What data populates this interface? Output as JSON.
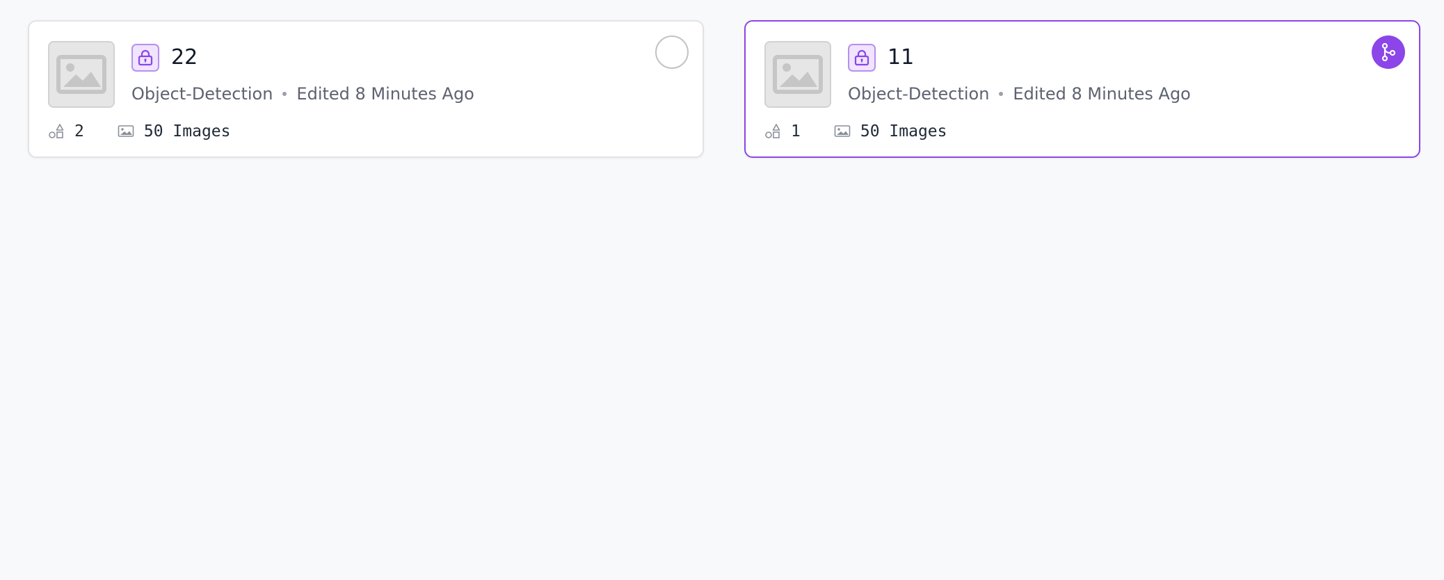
{
  "cards": [
    {
      "title": "22",
      "type": "Object-Detection",
      "edited": "Edited 8 Minutes Ago",
      "classes_count": "2",
      "images_label": "50 Images",
      "selected": false
    },
    {
      "title": "11",
      "type": "Object-Detection",
      "edited": "Edited 8 Minutes Ago",
      "classes_count": "1",
      "images_label": "50 Images",
      "selected": true
    }
  ],
  "icons": {
    "thumbnail": "image-placeholder-icon",
    "lock": "lock-icon",
    "classes": "shapes-icon",
    "images": "image-icon",
    "selected": "git-fork-icon"
  },
  "colors": {
    "accent": "#8b45e8",
    "background": "#f8f9fa",
    "card_border": "#e3e3e6",
    "muted_text": "#5e6270"
  }
}
